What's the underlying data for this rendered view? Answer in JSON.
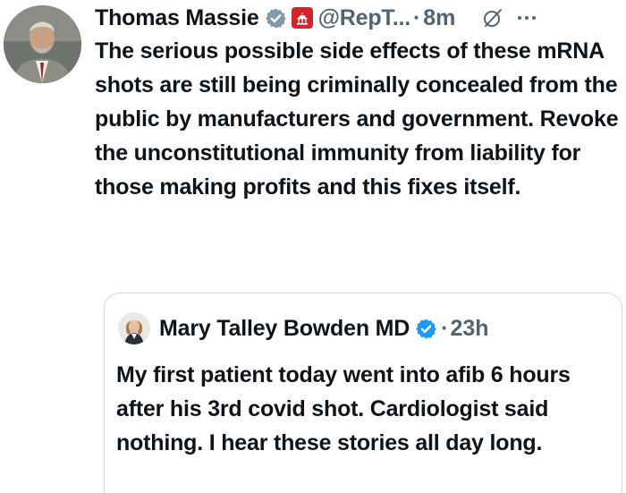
{
  "tweet": {
    "author_name": "Thomas Massie",
    "handle": "@RepT...",
    "separator": "·",
    "time": "8m",
    "text": "The serious possible side effects of these mRNA shots are still being criminally concealed from the public by manufacturers and government. Revoke the unconstitutional immunity from liability for those making profits and this fixes itself.",
    "icons": [
      "verified-icon",
      "government-badge-icon",
      "grok-icon",
      "more-icon"
    ]
  },
  "quoted_tweet": {
    "author_name": "Mary Talley Bowden MD",
    "separator": "·",
    "time": "23h",
    "text": "My first patient today went into afib 6 hours after his 3rd covid shot. Cardiologist said nothing.  I hear these stories all day long.",
    "icons": [
      "verified-icon"
    ]
  },
  "colors": {
    "verified_blue": "#1d9bf0",
    "gov_badge_red": "#d0272f",
    "secondary_text": "#536471",
    "border": "#cfd9de"
  }
}
